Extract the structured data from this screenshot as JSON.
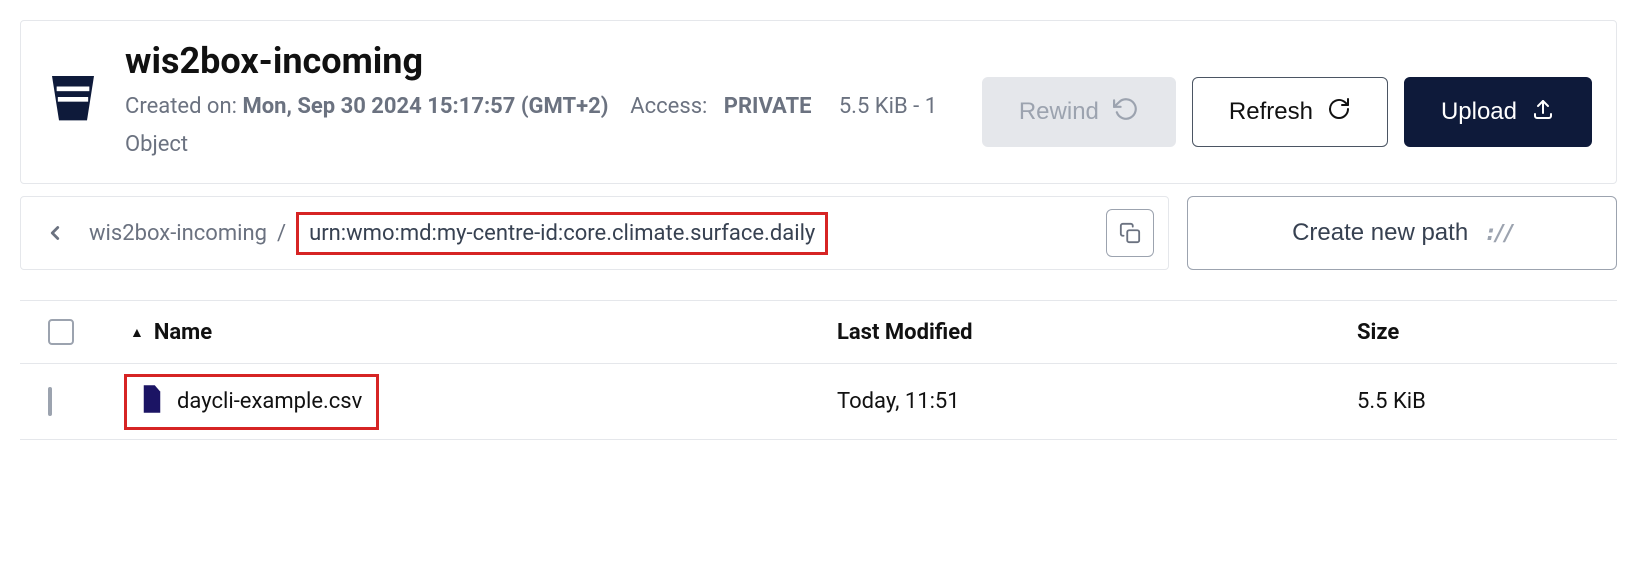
{
  "colors": {
    "accent": "#0e1a3a",
    "highlight": "#d62424",
    "muted": "#6b7280",
    "border": "#e5e7eb"
  },
  "header": {
    "bucket_name": "wis2box-incoming",
    "created_label": "Created on:",
    "created_value": "Mon, Sep 30 2024 15:17:57 (GMT+2)",
    "access_label": "Access:",
    "access_value": "PRIVATE",
    "size": "5.5 KiB",
    "object_count": "1 Object"
  },
  "actions": {
    "rewind": "Rewind",
    "refresh": "Refresh",
    "upload": "Upload"
  },
  "path": {
    "root": "wis2box-incoming",
    "current": "urn:wmo:md:my-centre-id:core.climate.surface.daily",
    "create_label": "Create new path"
  },
  "table": {
    "columns": {
      "name": "Name",
      "last_modified": "Last Modified",
      "size": "Size"
    },
    "rows": [
      {
        "name": "daycli-example.csv",
        "last_modified": "Today, 11:51",
        "size": "5.5 KiB"
      }
    ]
  },
  "icons": {
    "bucket": "bucket-icon",
    "rewind": "rewind-icon",
    "refresh": "refresh-icon",
    "upload": "upload-icon",
    "back": "chevron-left-icon",
    "copy": "copy-icon",
    "path_slash": "path-slash-icon",
    "sort": "sort-asc-icon",
    "file": "file-icon"
  }
}
